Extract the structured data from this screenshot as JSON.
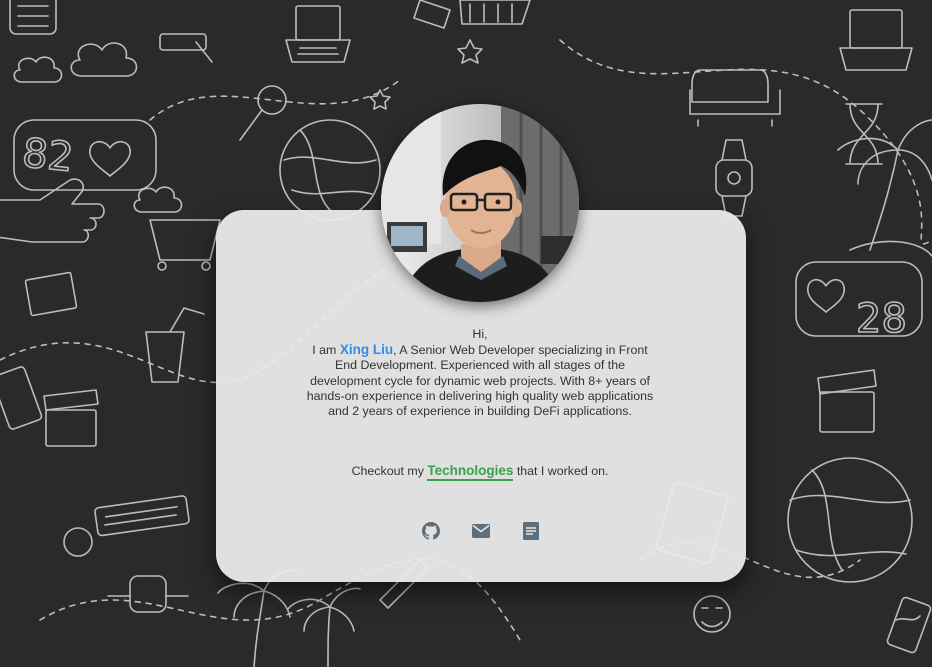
{
  "profile": {
    "greeting": "Hi,",
    "intro_prefix": "I am",
    "name": "Xing Liu",
    "intro_body": ", A Senior Web Developer specializing in Front End Development. Experienced with all stages of the development cycle for dynamic web projects. With 8+ years of hands-on experience in delivering high quality web applications and 2 years of experience in building DeFi applications.",
    "checkout_prefix": "Checkout my",
    "technologies_link": "Technologies",
    "checkout_suffix": "that I worked on."
  },
  "social_icons": [
    "github-icon",
    "mail-icon",
    "resume-icon"
  ],
  "colors": {
    "background": "#2b2b2b",
    "card": "#ececec",
    "name": "#2f8de4",
    "link": "#3aa14c",
    "icon": "#5d6f7e"
  }
}
